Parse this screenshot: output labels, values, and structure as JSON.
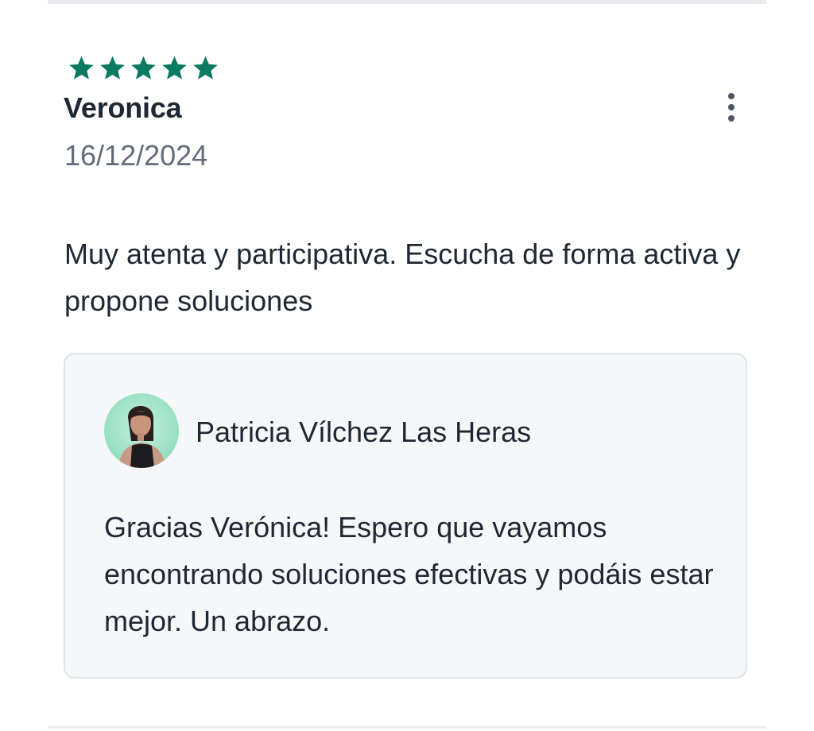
{
  "review": {
    "rating": 5,
    "rating_max": 5,
    "star_color": "#0a7b60",
    "reviewer_name": "Veronica",
    "date": "16/12/2024",
    "text": "Muy atenta y participativa. Escucha de forma activa y propone soluciones",
    "more_icon": "more-vertical-icon"
  },
  "reply": {
    "responder_name": "Patricia Vílchez Las Heras",
    "avatar_icon": "profile-photo",
    "text": "Gracias Verónica! Espero que vayamos encontrando soluciones efectivas y podáis estar mejor. Un abrazo."
  }
}
